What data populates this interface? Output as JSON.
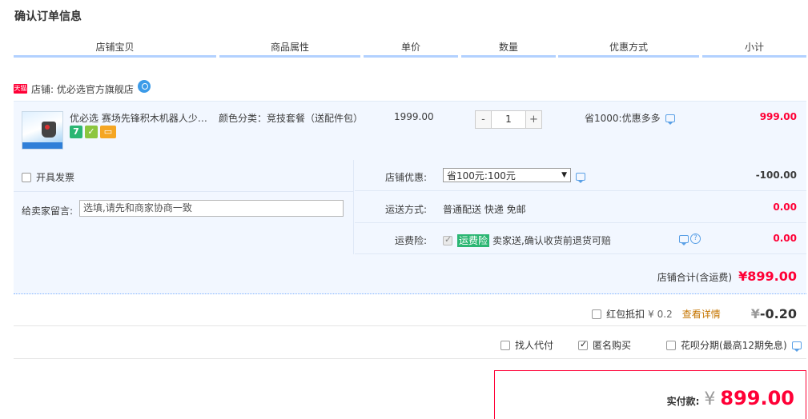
{
  "page_title": "确认订单信息",
  "columns": [
    "店铺宝贝",
    "商品属性",
    "单价",
    "数量",
    "优惠方式",
    "小计"
  ],
  "shop": {
    "badge": "天猫",
    "label": "店铺: 优必选官方旗舰店"
  },
  "item": {
    "title": "优必选 赛场先锋积木机器人少…",
    "props": "颜色分类：竞技套餐（送配件包）",
    "price": "1999.00",
    "qty_minus": "-",
    "quantity": "1",
    "qty_plus": "+",
    "discount": "省1000:优惠多多",
    "subtotal": "999.00",
    "badges": [
      "7",
      "✓",
      "▭"
    ]
  },
  "invoice_label": "开具发票",
  "note": {
    "label": "给卖家留言:",
    "placeholder": "选填,请先和商家协商一致"
  },
  "shop_discount": {
    "label": "店铺优惠:",
    "selected": "省100元:100元",
    "amount": "-100.00"
  },
  "shipping": {
    "label": "运送方式:",
    "value": "普通配送 快递 免邮",
    "amount": "0.00"
  },
  "insurance": {
    "label": "运费险:",
    "tag": "运费险",
    "desc": "卖家送,确认收货前退货可赔",
    "amount": "0.00"
  },
  "shop_total": {
    "label": "店铺合计(含运费)",
    "amount": "¥899.00"
  },
  "red_packet": {
    "label": "红包抵扣",
    "balance": "¥ 0.2",
    "link": "查看详情",
    "yen": "¥",
    "amount": "-0.20"
  },
  "extras": {
    "proxy": "找人代付",
    "anonymous": "匿名购买",
    "huabei": "花呗分期(最高12期免息)"
  },
  "pay": {
    "label": "实付款:",
    "yen": "¥",
    "amount": "899.00"
  },
  "colors": {
    "accent": "#ff0036",
    "header_line": "#b2d1ff",
    "row_bg": "#f2f7ff",
    "green": "#2bb673"
  }
}
